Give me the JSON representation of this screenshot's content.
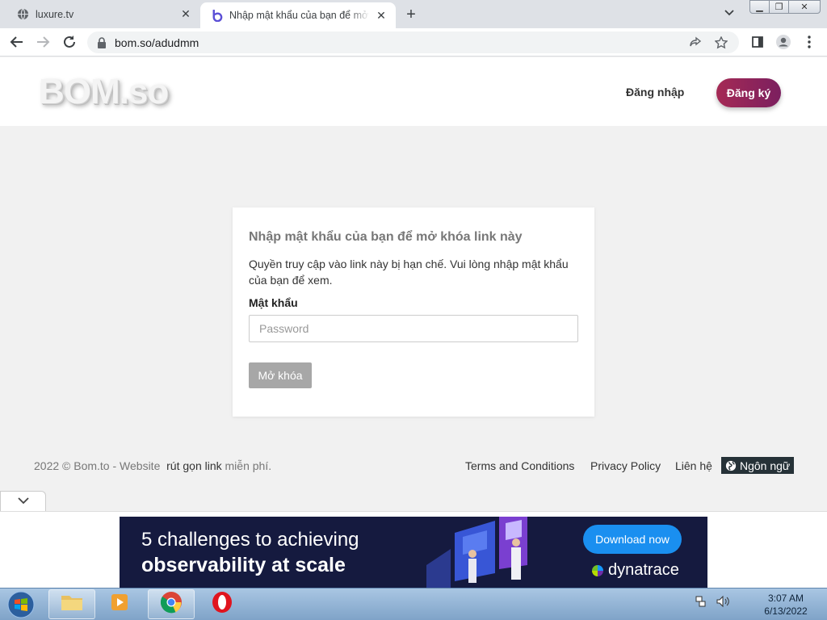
{
  "browser": {
    "tabs": [
      {
        "title": "luxure.tv",
        "active": false
      },
      {
        "title": "Nhập mật khẩu của bạn để mở khóa link này",
        "active": true
      }
    ],
    "address": "bom.so/adudmm"
  },
  "header": {
    "logo": "BOM.so",
    "login": "Đăng nhập",
    "register": "Đăng ký"
  },
  "card": {
    "title": "Nhập mật khẩu của bạn để mở khóa link này",
    "description": "Quyền truy cập vào link này bị hạn chế. Vui lòng nhập mật khẩu của bạn để xem.",
    "password_label": "Mật khẩu",
    "password_placeholder": "Password",
    "password_value": "",
    "unlock": "Mở khóa"
  },
  "footer": {
    "copyright": "2022 © Bom.to - Website",
    "shortlink": "rút gọn link",
    "free": "miễn phí.",
    "terms": "Terms and Conditions",
    "privacy": "Privacy Policy",
    "contact": "Liên hệ",
    "language": "Ngôn ngữ"
  },
  "ad": {
    "line1": "5 challenges to achieving",
    "line2": "observability at scale",
    "cta": "Download now",
    "brand": "dynatrace"
  },
  "taskbar": {
    "time": "3:07 AM",
    "date": "6/13/2022"
  },
  "colors": {
    "register_gradient": [
      "#a52a55",
      "#7b1f5f"
    ],
    "ad_background": "#151a3f",
    "ad_cta": "#1a8ff0",
    "language_button": "#263238"
  }
}
